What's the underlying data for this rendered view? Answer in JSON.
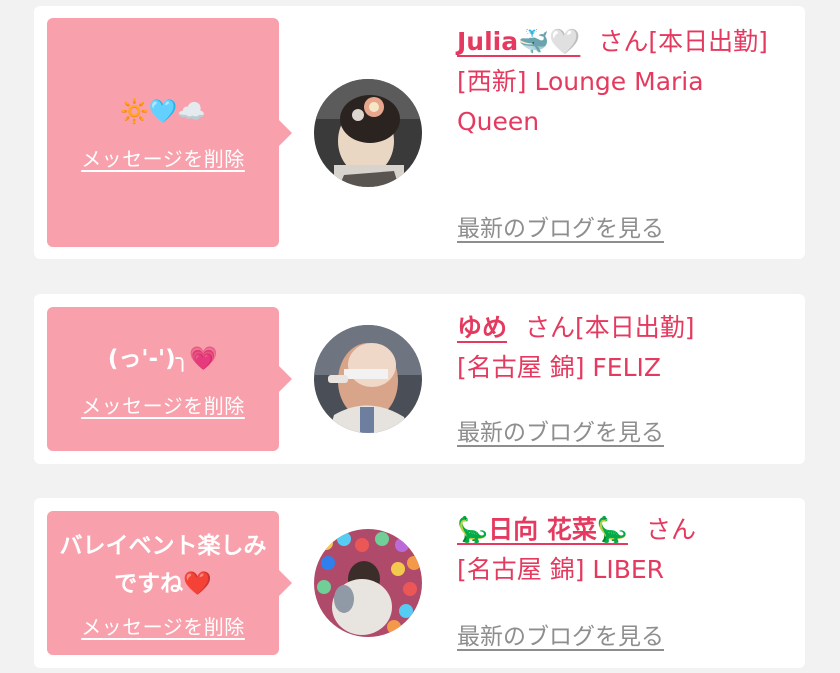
{
  "entries": [
    {
      "message": "🔆🩵☁️",
      "delete_label": "メッセージを削除",
      "name": "Julia🐳🤍",
      "honorific": "さん",
      "status": "[本日出勤]",
      "shop": "[西新] Lounge Maria Queen",
      "blog_label": "最新のブログを見る"
    },
    {
      "message": "(っ'-')╮💗",
      "delete_label": "メッセージを削除",
      "name": "ゆめ",
      "honorific": "さん",
      "status": "[本日出勤]",
      "shop": "[名古屋 錦] FELIZ",
      "blog_label": "最新のブログを見る"
    },
    {
      "message": "バレイベント楽しみですね❤️",
      "delete_label": "メッセージを削除",
      "name": "🦕日向 花菜🦕",
      "honorific": "さん",
      "status": "",
      "shop": "[名古屋 錦] LIBER",
      "blog_label": "最新のブログを見る"
    }
  ],
  "colors": {
    "page_background": "#f2f2f2",
    "card_background": "#ffffff",
    "bubble": "#f8a0ab",
    "accent_text": "#e53a5f",
    "link_gray": "#8e8e8e"
  }
}
